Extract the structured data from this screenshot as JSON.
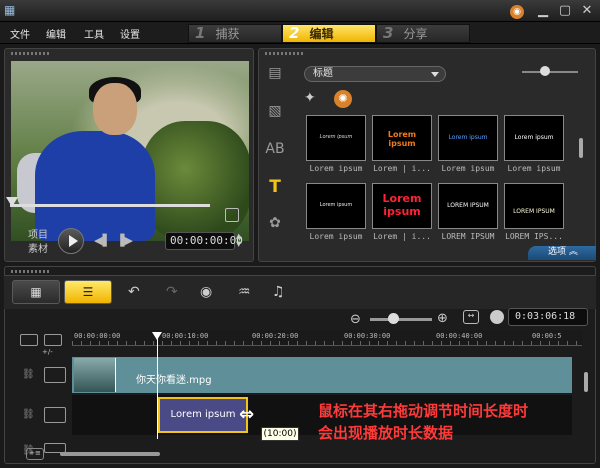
{
  "menu": [
    "文件",
    "编辑",
    "工具",
    "设置"
  ],
  "steps": [
    {
      "num": "1",
      "label": "捕获"
    },
    {
      "num": "2",
      "label": "编辑"
    },
    {
      "num": "3",
      "label": "分享"
    }
  ],
  "player": {
    "mode_project": "项目",
    "mode_clip": "素材",
    "timecode": "00:00:00:00"
  },
  "library": {
    "category": "标题",
    "thumbs": [
      {
        "caption": "Lorem ipsum",
        "text": "Lorem ipsum"
      },
      {
        "caption": "Lorem | i...",
        "text": "Lorem ipsum"
      },
      {
        "caption": "Lorem ipsum",
        "text": "Lorem ipsum"
      },
      {
        "caption": "Lorem ipsum",
        "text": "Lorem ipsum"
      },
      {
        "caption": "Lorem ipsum",
        "text": "Lorem ipsum"
      },
      {
        "caption": "Lorem | i...",
        "text": "Lorem ipsum"
      },
      {
        "caption": "LOREM IPSUM",
        "text": "LOREM IPSUM"
      },
      {
        "caption": "LOREM IPS...",
        "text": "LOREM IPSUM"
      }
    ],
    "options_label": "选项"
  },
  "timeline": {
    "duration": "0:03:06:18",
    "ruler": [
      "00:00:00:00",
      "00:00:10:00",
      "00:00:20:00",
      "00:00:30:00",
      "00:00:40:00",
      "00:00:5"
    ],
    "video_clip_name": "你天你看迷.mpg",
    "title_clip_text": "Lorem ipsum",
    "duration_tooltip": "(10:00)",
    "track_add_label": "+/-"
  },
  "annotation": {
    "line1": "鼠标在其右拖动调节时间长度时",
    "line2": "会出现播放时长数据"
  },
  "colors": {
    "accent": "#f3c316",
    "annotation": "#ff3a3a",
    "video_track": "#5f8f98",
    "title_clip": "#4a4b86"
  }
}
